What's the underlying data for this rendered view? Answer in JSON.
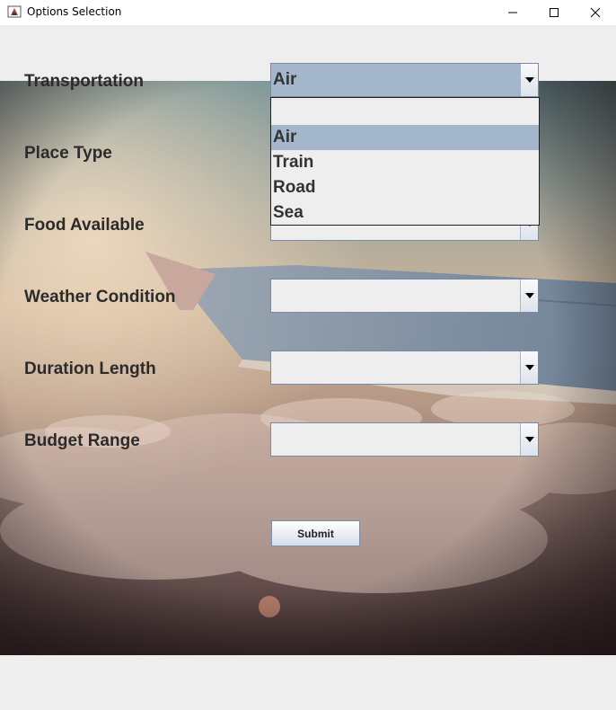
{
  "window": {
    "title": "Options Selection",
    "icon": "java-app-icon"
  },
  "form": {
    "fields": [
      {
        "label": "Transportation",
        "value": "Air"
      },
      {
        "label": "Place Type",
        "value": ""
      },
      {
        "label": "Food Available",
        "value": ""
      },
      {
        "label": "Weather Condition",
        "value": ""
      },
      {
        "label": "Duration Length",
        "value": ""
      },
      {
        "label": "Budget Range",
        "value": ""
      }
    ],
    "dropdown": {
      "options": [
        "",
        "Air",
        "Train",
        "Road",
        "Sea"
      ],
      "selected": "Air"
    },
    "submit_label": "Submit"
  },
  "colors": {
    "selection": "#a3b6cb",
    "control_bg": "#eeeeee",
    "border": "#7a8aa6"
  }
}
